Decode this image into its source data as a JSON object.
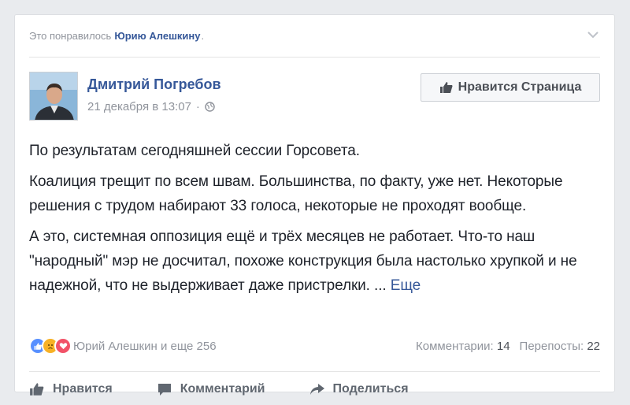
{
  "story": {
    "prefix": "Это понравилось",
    "liker_name": "Юрию Алешкину",
    "suffix": "."
  },
  "post": {
    "author": "Дмитрий Погребов",
    "date": "21 декабря в 13:07",
    "separator": "·",
    "page_like_label": "Нравится Страница",
    "paragraphs": [
      "По результатам сегодняшней сессии Горсовета.",
      "Коалиция трещит по всем швам. Большинства, по факту, уже нет. Некоторые решения с трудом набирают 33 голоса, некоторые не проходят вообще.",
      "А это, системная оппозиция ещё и трёх месяцев не работает. Что-то наш \"народный\" мэр не досчитал, похоже конструкция была настолько хрупкой и не надежной, что не выдерживает даже пристрелки. ..."
    ],
    "more_label": "Еще"
  },
  "reactions": {
    "summary": "Юрий Алешкин и еще 256",
    "comments_label": "Комментарии:",
    "comments_count": "14",
    "shares_label": "Перепосты:",
    "shares_count": "22"
  },
  "actions": {
    "like": "Нравится",
    "comment": "Комментарий",
    "share": "Поделиться"
  },
  "colors": {
    "link": "#365899",
    "muted": "#90949c",
    "like_reaction": "#5890ff",
    "sad_reaction": "#f7b125",
    "love_reaction": "#f25268"
  },
  "icons": {
    "chevron": "chevron-down-icon",
    "globe": "globe-icon",
    "thumbs_up": "thumbs-up-icon",
    "comment": "comment-icon",
    "share": "share-icon"
  }
}
